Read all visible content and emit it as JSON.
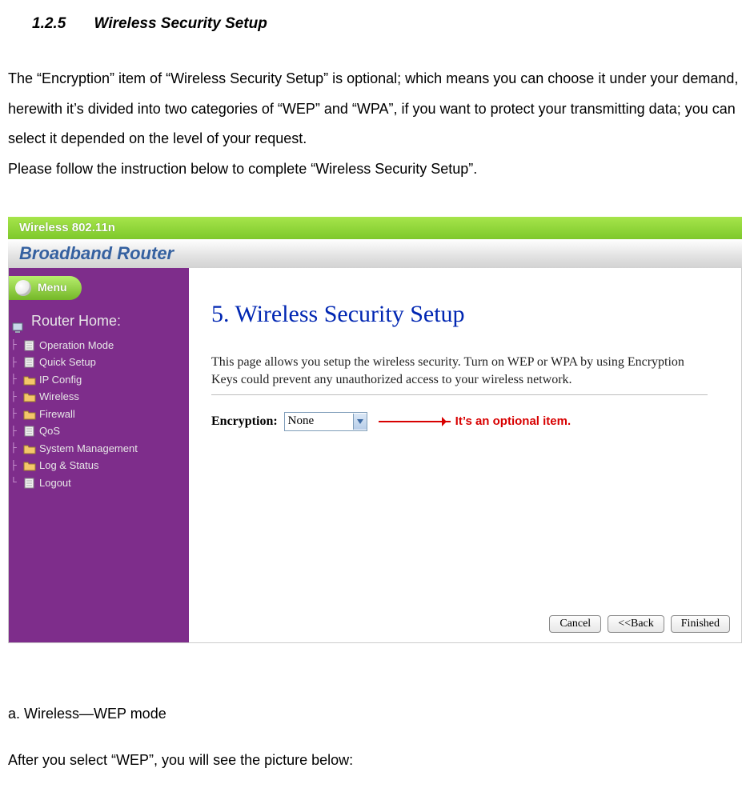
{
  "section": {
    "number": "1.2.5",
    "title": "Wireless Security Setup"
  },
  "intro": {
    "p1": "The “Encryption” item of “Wireless Security Setup” is optional; which means you can choose it under your demand, herewith it’s divided into two categories of “WEP” and “WPA”, if you want to protect your transmitting data; you can select it depended on the level of your request.",
    "p2": "Please follow the instruction below to complete “Wireless Security Setup”."
  },
  "screenshot": {
    "banner": "Wireless 802.11n",
    "product": "Broadband Router",
    "menu_label": "Menu",
    "router_home": "Router Home:",
    "items": [
      {
        "label": "Operation Mode",
        "type": "file"
      },
      {
        "label": "Quick Setup",
        "type": "file"
      },
      {
        "label": "IP Config",
        "type": "folder"
      },
      {
        "label": "Wireless",
        "type": "folder"
      },
      {
        "label": "Firewall",
        "type": "folder"
      },
      {
        "label": "QoS",
        "type": "file"
      },
      {
        "label": "System Management",
        "type": "folder"
      },
      {
        "label": "Log & Status",
        "type": "folder"
      },
      {
        "label": "Logout",
        "type": "file"
      }
    ],
    "step_title": "5. Wireless Security Setup",
    "description": "This page allows you setup the wireless security. Turn on WEP or WPA by using Encryption Keys could prevent any unauthorized access to your wireless network.",
    "encryption_label": "Encryption:",
    "encryption_value": "None",
    "annotation": "It’s an optional item.",
    "buttons": {
      "cancel": "Cancel",
      "back": "<<Back",
      "finished": "Finished"
    }
  },
  "after": {
    "sub": "a. Wireless—WEP mode",
    "line": "After you select “WEP”, you will see the picture below:"
  }
}
